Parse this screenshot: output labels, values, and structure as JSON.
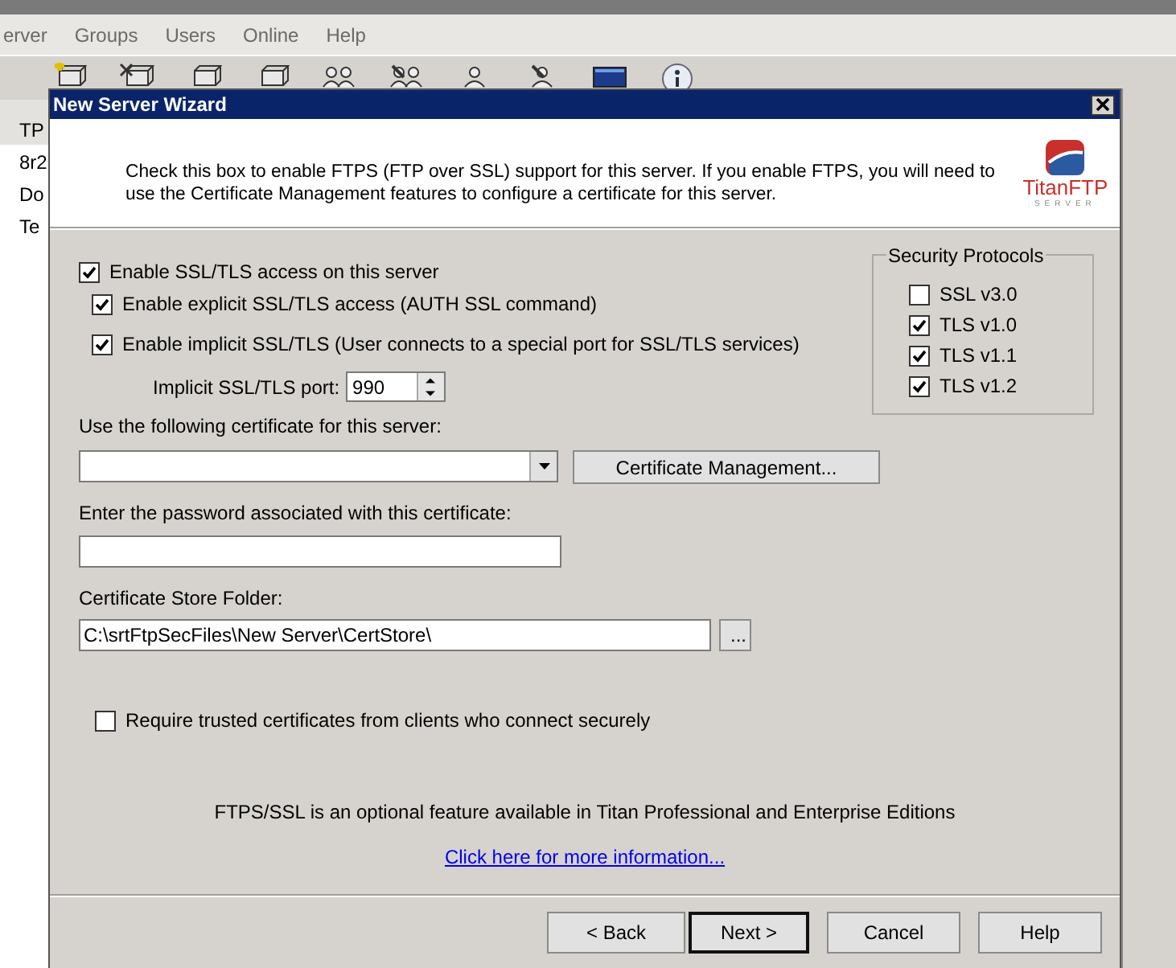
{
  "app": {
    "menu": [
      "erver",
      "Groups",
      "Users",
      "Online",
      "Help"
    ],
    "list_header": "TP",
    "sidebar": [
      "8r2",
      "Do",
      "Te"
    ]
  },
  "dialog": {
    "title": "New Server Wizard",
    "header": {
      "text": "Check this box to enable FTPS (FTP over SSL) support for this server. If you enable FTPS, you will need to use the Certificate Management features to configure a certificate for this server.",
      "logo": "TitanFTP",
      "logo_tagline": "SERVER"
    },
    "options": [
      {
        "label": "Enable SSL/TLS access on this server",
        "checked": true,
        "children": [
          {
            "label": "Enable explicit SSL/TLS access (AUTH SSL command)",
            "checked": true
          },
          {
            "label": "Enable implicit SSL/TLS (User connects to a special port for SSL/TLS services)",
            "checked": true
          }
        ]
      }
    ],
    "port": {
      "label": "Implicit SSL/TLS port:",
      "value": "990"
    },
    "protocols": {
      "title": "Security Protocols",
      "items": [
        {
          "label": "SSL v3.0",
          "checked": false
        },
        {
          "label": "TLS v1.0",
          "checked": true
        },
        {
          "label": "TLS v1.1",
          "checked": true
        },
        {
          "label": "TLS v1.2",
          "checked": true
        }
      ]
    },
    "certificate": {
      "label": "Use the following certificate for this server:",
      "button": "Certificate Management..."
    },
    "password": {
      "label": "Enter the password associated with this certificate:"
    },
    "store": {
      "label": "Certificate Store Folder:",
      "value": "C:\\srtFtpSecFiles\\New Server\\CertStore\\",
      "browse": "..."
    },
    "require_trusted": {
      "label": "Require trusted certificates from clients who connect securely",
      "checked": false
    },
    "note": "FTPS/SSL is an optional feature available in Titan Professional and Enterprise Editions",
    "link": "Click here for more information...",
    "buttons": [
      {
        "label": "< Back",
        "default": false
      },
      {
        "label": "Next >",
        "default": true
      },
      {
        "label": "Cancel",
        "default": false
      },
      {
        "label": "Help",
        "default": false
      }
    ]
  }
}
